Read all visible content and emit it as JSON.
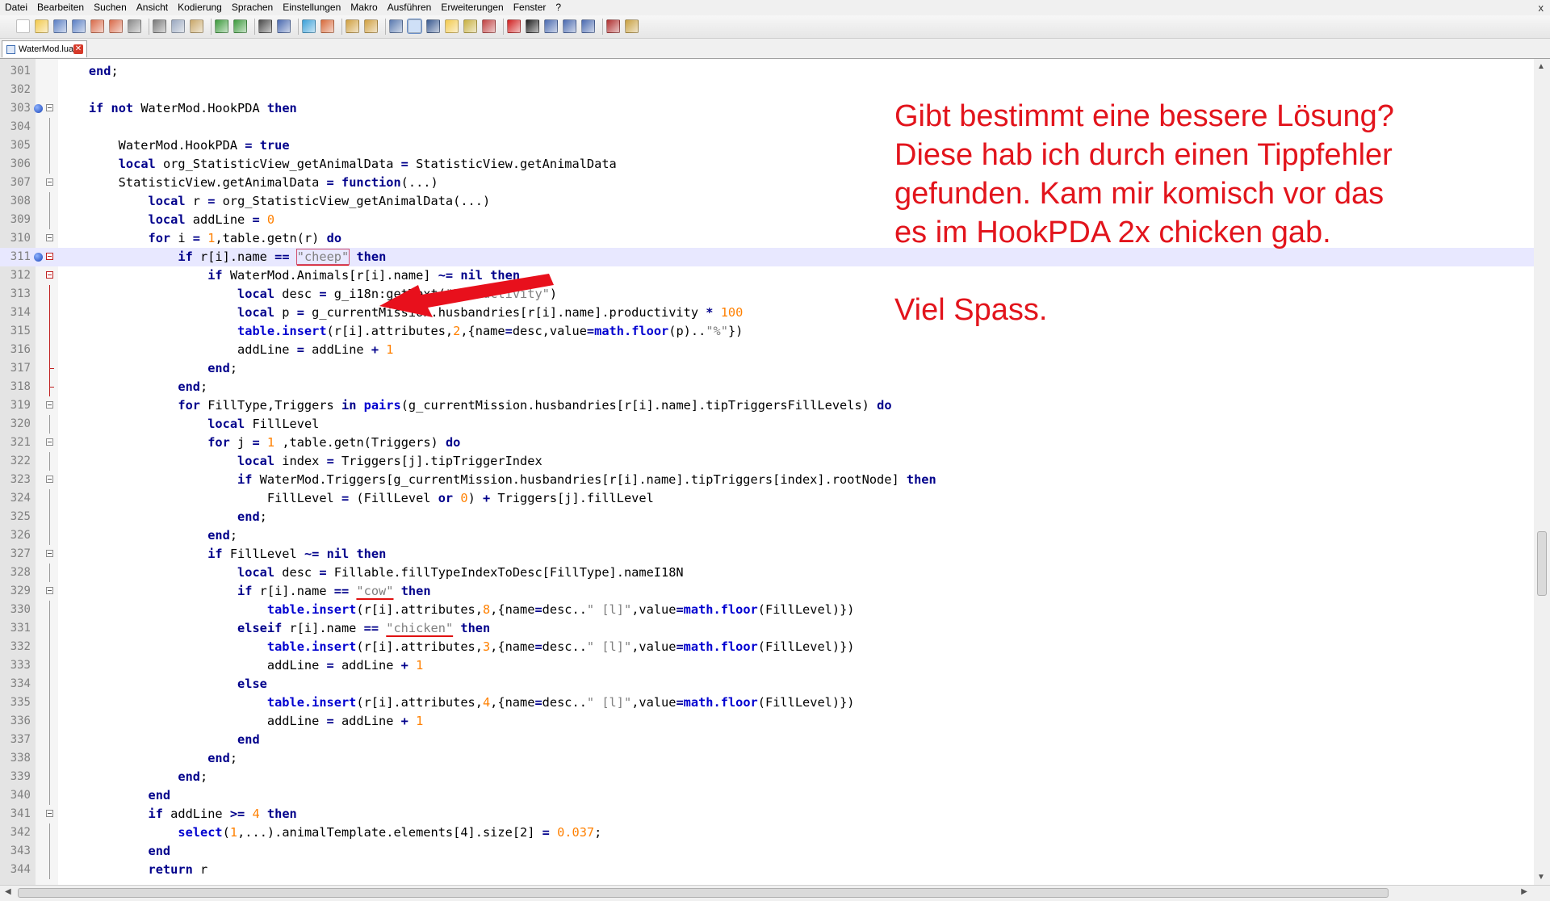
{
  "menu": [
    "Datei",
    "Bearbeiten",
    "Suchen",
    "Ansicht",
    "Kodierung",
    "Sprachen",
    "Einstellungen",
    "Makro",
    "Ausführen",
    "Erweiterungen",
    "Fenster",
    "?"
  ],
  "window": {
    "close_label": "x"
  },
  "tab": {
    "filename": "WaterMod.lua",
    "close_label": "✕"
  },
  "annotation": {
    "lines": [
      "Gibt bestimmt eine bessere Lösung?",
      "Diese hab ich durch einen Tippfehler",
      "gefunden. Kam mir komisch vor das",
      "es im HookPDA 2x chicken gab.",
      "",
      "Viel Spass."
    ],
    "color": "#e2141c"
  },
  "editor": {
    "highlight_line": "311",
    "lines": [
      {
        "n": "301",
        "t": "    end;"
      },
      {
        "n": "302",
        "t": ""
      },
      {
        "n": "303",
        "t": "    if not WaterMod.HookPDA then"
      },
      {
        "n": "304",
        "t": ""
      },
      {
        "n": "305",
        "t": "        WaterMod.HookPDA = true"
      },
      {
        "n": "306",
        "t": "        local org_StatisticView_getAnimalData = StatisticView.getAnimalData"
      },
      {
        "n": "307",
        "t": "        StatisticView.getAnimalData = function(...)"
      },
      {
        "n": "308",
        "t": "            local r = org_StatisticView_getAnimalData(...)"
      },
      {
        "n": "309",
        "t": "            local addLine = 0"
      },
      {
        "n": "310",
        "t": "            for i = 1,table.getn(r) do"
      },
      {
        "n": "311",
        "t": "                if r[i].name == \"cheep\" then"
      },
      {
        "n": "312",
        "t": "                    if WaterMod.Animals[r[i].name] ~= nil then"
      },
      {
        "n": "313",
        "t": "                        local desc = g_i18n:getText(\"Productivity\")"
      },
      {
        "n": "314",
        "t": "                        local p = g_currentMission.husbandries[r[i].name].productivity * 100"
      },
      {
        "n": "315",
        "t": "                        table.insert(r[i].attributes,2,{name=desc,value=math.floor(p)..\"%\"})"
      },
      {
        "n": "316",
        "t": "                        addLine = addLine + 1"
      },
      {
        "n": "317",
        "t": "                    end;"
      },
      {
        "n": "318",
        "t": "                end;"
      },
      {
        "n": "319",
        "t": "                for FillType,Triggers in pairs(g_currentMission.husbandries[r[i].name].tipTriggersFillLevels) do"
      },
      {
        "n": "320",
        "t": "                    local FillLevel"
      },
      {
        "n": "321",
        "t": "                    for j = 1 ,table.getn(Triggers) do"
      },
      {
        "n": "322",
        "t": "                        local index = Triggers[j].tipTriggerIndex"
      },
      {
        "n": "323",
        "t": "                        if WaterMod.Triggers[g_currentMission.husbandries[r[i].name].tipTriggers[index].rootNode] then"
      },
      {
        "n": "324",
        "t": "                            FillLevel = (FillLevel or 0) + Triggers[j].fillLevel"
      },
      {
        "n": "325",
        "t": "                        end;"
      },
      {
        "n": "326",
        "t": "                    end;"
      },
      {
        "n": "327",
        "t": "                    if FillLevel ~= nil then"
      },
      {
        "n": "328",
        "t": "                        local desc = Fillable.fillTypeIndexToDesc[FillType].nameI18N"
      },
      {
        "n": "329",
        "t": "                        if r[i].name == \"cow\" then"
      },
      {
        "n": "330",
        "t": "                            table.insert(r[i].attributes,8,{name=desc..\" [l]\",value=math.floor(FillLevel)})"
      },
      {
        "n": "331",
        "t": "                        elseif r[i].name == \"chicken\" then"
      },
      {
        "n": "332",
        "t": "                            table.insert(r[i].attributes,3,{name=desc..\" [l]\",value=math.floor(FillLevel)})"
      },
      {
        "n": "333",
        "t": "                            addLine = addLine + 1"
      },
      {
        "n": "334",
        "t": "                        else"
      },
      {
        "n": "335",
        "t": "                            table.insert(r[i].attributes,4,{name=desc..\" [l]\",value=math.floor(FillLevel)})"
      },
      {
        "n": "336",
        "t": "                            addLine = addLine + 1"
      },
      {
        "n": "337",
        "t": "                        end"
      },
      {
        "n": "338",
        "t": "                    end;"
      },
      {
        "n": "339",
        "t": "                end;"
      },
      {
        "n": "340",
        "t": "            end"
      },
      {
        "n": "341",
        "t": "            if addLine >= 4 then"
      },
      {
        "n": "342",
        "t": "                select(1,...).animalTemplate.elements[4].size[2] = 0.037;"
      },
      {
        "n": "343",
        "t": "            end"
      },
      {
        "n": "344",
        "t": "            return r"
      }
    ],
    "fold_open": [
      "303",
      "307",
      "310",
      "311",
      "312",
      "319",
      "321",
      "323",
      "327",
      "329",
      "341"
    ],
    "fold_red": [
      "311",
      "312"
    ],
    "bookmarks": [
      "303",
      "311"
    ],
    "fold_end": [
      "317",
      "318"
    ]
  },
  "toolbar": {
    "buttons": [
      {
        "name": "new-file-icon",
        "color": "#ffffff"
      },
      {
        "name": "open-file-icon",
        "color": "#f2c94c"
      },
      {
        "name": "save-icon",
        "color": "#5b7fc4"
      },
      {
        "name": "save-all-icon",
        "color": "#5b7fc4"
      },
      {
        "name": "close-file-icon",
        "color": "#d96b4a"
      },
      {
        "name": "close-all-icon",
        "color": "#d96b4a"
      },
      {
        "name": "print-icon",
        "color": "#8a8a8a"
      },
      {
        "name": "cut-icon",
        "color": "#7a7a7a"
      },
      {
        "name": "copy-icon",
        "color": "#9aa8c0"
      },
      {
        "name": "paste-icon",
        "color": "#c9a86a"
      },
      {
        "name": "undo-icon",
        "color": "#3c9a3c"
      },
      {
        "name": "redo-icon",
        "color": "#3c9a3c"
      },
      {
        "name": "find-icon",
        "color": "#4a4a4a"
      },
      {
        "name": "replace-icon",
        "color": "#4a6ab0"
      },
      {
        "name": "zoom-in-icon",
        "color": "#3aa0d8"
      },
      {
        "name": "zoom-out-icon",
        "color": "#d86a3a"
      },
      {
        "name": "sync-vertical-icon",
        "color": "#d0a040"
      },
      {
        "name": "sync-horizontal-icon",
        "color": "#d0a040"
      },
      {
        "name": "word-wrap-icon",
        "color": "#5a7ab0"
      },
      {
        "name": "show-all-chars-icon",
        "color": "#2a6ad0"
      },
      {
        "name": "indent-guide-icon",
        "color": "#3a5a90"
      },
      {
        "name": "user-language-icon",
        "color": "#f2c94c"
      },
      {
        "name": "document-map-icon",
        "color": "#c8b040"
      },
      {
        "name": "function-list-icon",
        "color": "#c04040"
      },
      {
        "name": "record-macro-icon",
        "color": "#d02020"
      },
      {
        "name": "stop-record-icon",
        "color": "#202020"
      },
      {
        "name": "play-macro-icon",
        "color": "#4a6ab0"
      },
      {
        "name": "run-macro-multiple-icon",
        "color": "#4a6ab0"
      },
      {
        "name": "save-macro-icon",
        "color": "#4a6ab0"
      },
      {
        "name": "spell-check-icon",
        "color": "#b03030"
      },
      {
        "name": "plugin-icon",
        "color": "#c8a040"
      }
    ],
    "toggled": [
      "show-all-chars-icon"
    ]
  }
}
